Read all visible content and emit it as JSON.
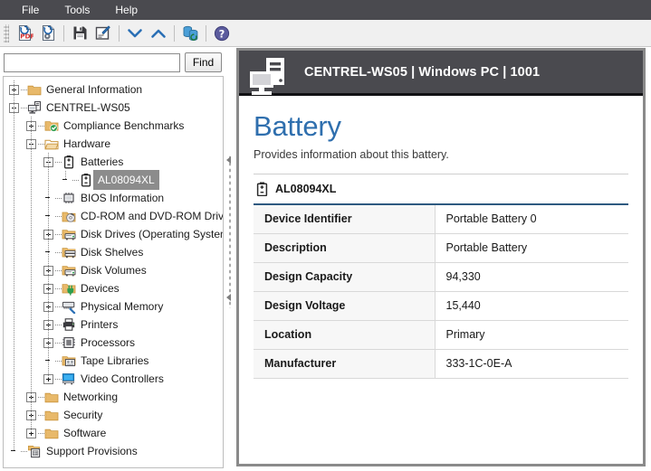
{
  "menubar": {
    "items": [
      {
        "label": "File",
        "name": "menu-file"
      },
      {
        "label": "Tools",
        "name": "menu-tools"
      },
      {
        "label": "Help",
        "name": "menu-help"
      }
    ]
  },
  "toolbar": {
    "buttons": [
      {
        "icon": "export-pdf-icon"
      },
      {
        "icon": "export-package-icon"
      },
      {
        "sep": true
      },
      {
        "icon": "save-icon"
      },
      {
        "icon": "edit-note-icon"
      },
      {
        "sep": true
      },
      {
        "icon": "chevron-down-icon"
      },
      {
        "icon": "chevron-up-icon"
      },
      {
        "sep": true
      },
      {
        "icon": "refresh-database-icon"
      },
      {
        "sep": true
      },
      {
        "icon": "help-icon"
      }
    ]
  },
  "search": {
    "value": "",
    "placeholder": "",
    "find_label": "Find"
  },
  "tree": {
    "items": [
      {
        "label": "General Information",
        "indent": 0,
        "state": "plus",
        "icon": "folder-icon",
        "selected": false
      },
      {
        "label": "CENTREL-WS05",
        "indent": 0,
        "state": "minus",
        "icon": "computer-icon",
        "selected": false
      },
      {
        "label": "Compliance Benchmarks",
        "indent": 1,
        "state": "plus",
        "icon": "folder-check-icon",
        "selected": false
      },
      {
        "label": "Hardware",
        "indent": 1,
        "state": "minus",
        "icon": "folder-open-icon",
        "selected": false
      },
      {
        "label": "Batteries",
        "indent": 2,
        "state": "minus",
        "icon": "battery-icon",
        "selected": false
      },
      {
        "label": "AL08094XL",
        "indent": 3,
        "state": "none",
        "icon": "battery-icon",
        "selected": true
      },
      {
        "label": "BIOS Information",
        "indent": 2,
        "state": "none",
        "icon": "chip-icon",
        "selected": false
      },
      {
        "label": "CD-ROM and DVD-ROM Drives",
        "indent": 2,
        "state": "none",
        "icon": "disc-drive-icon",
        "selected": false
      },
      {
        "label": "Disk Drives (Operating System)",
        "indent": 2,
        "state": "plus",
        "icon": "disk-drive-icon",
        "selected": false
      },
      {
        "label": "Disk Shelves",
        "indent": 2,
        "state": "none",
        "icon": "disk-shelf-icon",
        "selected": false
      },
      {
        "label": "Disk Volumes",
        "indent": 2,
        "state": "plus",
        "icon": "disk-volume-icon",
        "selected": false
      },
      {
        "label": "Devices",
        "indent": 2,
        "state": "plus",
        "icon": "plug-icon",
        "selected": false
      },
      {
        "label": "Physical Memory",
        "indent": 2,
        "state": "plus",
        "icon": "memory-icon",
        "selected": false
      },
      {
        "label": "Printers",
        "indent": 2,
        "state": "plus",
        "icon": "printer-icon",
        "selected": false
      },
      {
        "label": "Processors",
        "indent": 2,
        "state": "plus",
        "icon": "processor-icon",
        "selected": false
      },
      {
        "label": "Tape Libraries",
        "indent": 2,
        "state": "none",
        "icon": "tape-library-icon",
        "selected": false
      },
      {
        "label": "Video Controllers",
        "indent": 2,
        "state": "plus",
        "icon": "video-controller-icon",
        "selected": false
      },
      {
        "label": "Networking",
        "indent": 1,
        "state": "plus",
        "icon": "folder-icon",
        "selected": false
      },
      {
        "label": "Security",
        "indent": 1,
        "state": "plus",
        "icon": "folder-icon",
        "selected": false
      },
      {
        "label": "Software",
        "indent": 1,
        "state": "plus",
        "icon": "folder-icon",
        "selected": false
      },
      {
        "label": "Support Provisions",
        "indent": 0,
        "state": "none",
        "icon": "provisions-icon",
        "selected": false
      }
    ]
  },
  "content": {
    "header_title": "CENTREL-WS05 | Windows PC | 1001",
    "page_title": "Battery",
    "page_subtitle": "Provides information about this battery.",
    "section_title": "AL08094XL",
    "rows": [
      {
        "key": "Device Identifier",
        "value": "Portable Battery 0"
      },
      {
        "key": "Description",
        "value": "Portable Battery"
      },
      {
        "key": "Design Capacity",
        "value": "94,330"
      },
      {
        "key": "Design Voltage",
        "value": "15,440"
      },
      {
        "key": "Location",
        "value": "Primary"
      },
      {
        "key": "Manufacturer",
        "value": "333-1C-0E-A"
      }
    ]
  },
  "colors": {
    "chrome_dark": "#4a4a4f",
    "accent_blue": "#2f6fae",
    "table_rule": "#2e5a80",
    "selection_gray": "#8c8c8c"
  }
}
